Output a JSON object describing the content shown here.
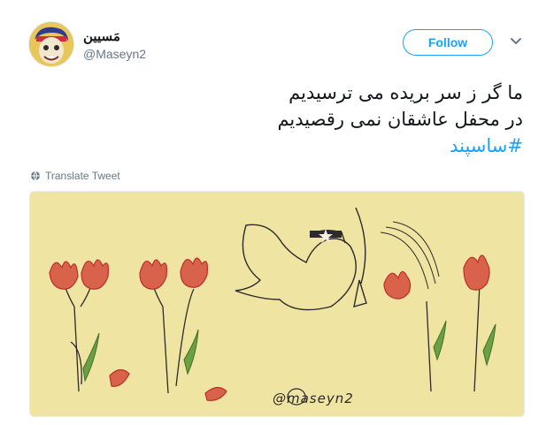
{
  "author": {
    "display_name": "مَسیین",
    "handle": "@Maseyn2"
  },
  "follow_label": "Follow",
  "tweet": {
    "line1": "ما گر ز سر بریده می ترسیدیم",
    "line2": "در محفل عاشقان نمی رقصیدیم",
    "hashtag": "#ساسپند"
  },
  "translate_label": "Translate Tweet",
  "media": {
    "watermark": "@maseyn2",
    "background_color": "#efe4a2"
  },
  "colors": {
    "accent": "#1da1f2",
    "secondary_text": "#657786"
  },
  "icons": [
    "chevron-down-icon",
    "globe-icon"
  ]
}
